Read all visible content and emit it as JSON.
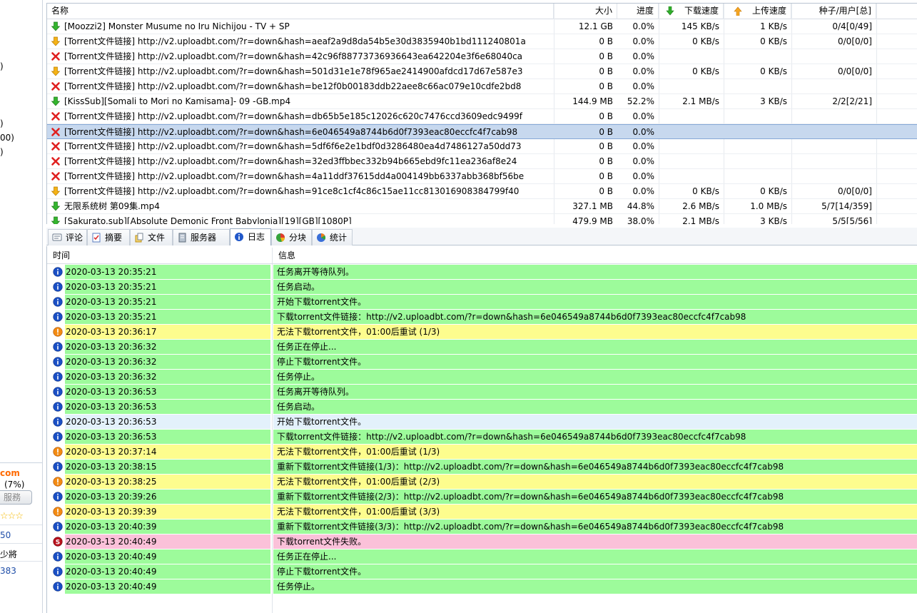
{
  "sidebar": {
    "fragments": [
      ")",
      ")",
      "00)",
      ")"
    ],
    "brand": "com",
    "percent": "(7%)",
    "service_button": "服務",
    "stars": "☆☆☆",
    "link1": "50",
    "text1": "少將",
    "link2": "383"
  },
  "torrent_list": {
    "columns": [
      "名称",
      "大小",
      "进度",
      "下载速度",
      "上传速度",
      "种子/用户[总]"
    ],
    "rows": [
      {
        "status": "downloading",
        "name": "[Moozzi2] Monster Musume no Iru Nichijou - TV + SP",
        "size": "12.1 GB",
        "progress": "0.0%",
        "down": "145 KB/s",
        "up": "1 KB/s",
        "peers": "0/4[0/49]"
      },
      {
        "status": "queued",
        "name": "[Torrent文件链接] http://v2.uploadbt.com/?r=down&hash=aeaf2a9d8da54b5e30d3835940b1bd111240801a",
        "size": "0 B",
        "progress": "0.0%",
        "down": "0 KB/s",
        "up": "0 KB/s",
        "peers": "0/0[0/0]"
      },
      {
        "status": "error",
        "name": "[Torrent文件链接] http://v2.uploadbt.com/?r=down&hash=42c96f88773736936643ea642204e3f6e68040ca",
        "size": "0 B",
        "progress": "0.0%",
        "down": "",
        "up": "",
        "peers": ""
      },
      {
        "status": "queued",
        "name": "[Torrent文件链接] http://v2.uploadbt.com/?r=down&hash=501d31e1e78f965ae2414900afdcd17d67e587e3",
        "size": "0 B",
        "progress": "0.0%",
        "down": "0 KB/s",
        "up": "0 KB/s",
        "peers": "0/0[0/0]"
      },
      {
        "status": "error",
        "name": "[Torrent文件链接] http://v2.uploadbt.com/?r=down&hash=be12f0b00183ddb22aee8c66ac079e10cdfe2bd8",
        "size": "0 B",
        "progress": "0.0%",
        "down": "",
        "up": "",
        "peers": ""
      },
      {
        "status": "downloading",
        "name": "[KissSub][Somali to Mori no Kamisama]- 09 -GB.mp4",
        "size": "144.9 MB",
        "progress": "52.2%",
        "down": "2.1 MB/s",
        "up": "3 KB/s",
        "peers": "2/2[2/21]"
      },
      {
        "status": "error",
        "name": "[Torrent文件链接] http://v2.uploadbt.com/?r=down&hash=db65b5e185c12026c620c7476ccd3609edc9499f",
        "size": "0 B",
        "progress": "0.0%",
        "down": "",
        "up": "",
        "peers": ""
      },
      {
        "status": "error",
        "selected": true,
        "name": "[Torrent文件链接] http://v2.uploadbt.com/?r=down&hash=6e046549a8744b6d0f7393eac80eccfc4f7cab98",
        "size": "0 B",
        "progress": "0.0%",
        "down": "",
        "up": "",
        "peers": ""
      },
      {
        "status": "error",
        "name": "[Torrent文件链接] http://v2.uploadbt.com/?r=down&hash=5df6f6e2e1bdf0d3286480ea4d7486127a50dd73",
        "size": "0 B",
        "progress": "0.0%",
        "down": "",
        "up": "",
        "peers": ""
      },
      {
        "status": "error",
        "name": "[Torrent文件链接] http://v2.uploadbt.com/?r=down&hash=32ed3ffbbec332b94b665ebd9fc11ea236af8e24",
        "size": "0 B",
        "progress": "0.0%",
        "down": "",
        "up": "",
        "peers": ""
      },
      {
        "status": "error",
        "name": "[Torrent文件链接] http://v2.uploadbt.com/?r=down&hash=4a11ddf37615dd4a004149bb6337abb368bf56be",
        "size": "0 B",
        "progress": "0.0%",
        "down": "",
        "up": "",
        "peers": ""
      },
      {
        "status": "queued",
        "name": "[Torrent文件链接] http://v2.uploadbt.com/?r=down&hash=91ce8c1cf4c86c15ae11cc813016908384799f40",
        "size": "0 B",
        "progress": "0.0%",
        "down": "0 KB/s",
        "up": "0 KB/s",
        "peers": "0/0[0/0]"
      },
      {
        "status": "downloading",
        "name": "无限系统树 第09集.mp4",
        "size": "327.1 MB",
        "progress": "44.8%",
        "down": "2.6 MB/s",
        "up": "1.0 MB/s",
        "peers": "5/7[14/359]"
      },
      {
        "status": "downloading",
        "name": "[Sakurato.sub][Absolute Demonic Front Babylonia][19][GB][1080P]",
        "size": "479.9 MB",
        "progress": "38.0%",
        "down": "2.1 MB/s",
        "up": "3 KB/s",
        "peers": "5/5[5/56]"
      }
    ]
  },
  "tabs": [
    {
      "label": "评论",
      "icon": "comment-icon"
    },
    {
      "label": "摘要",
      "icon": "summary-icon"
    },
    {
      "label": "文件",
      "icon": "file-icon"
    },
    {
      "label": "服务器",
      "icon": "server-icon"
    },
    {
      "label": "日志",
      "icon": "info-icon",
      "active": true
    },
    {
      "label": "分块",
      "icon": "pieces-icon"
    },
    {
      "label": "统计",
      "icon": "stats-icon"
    }
  ],
  "log": {
    "columns": [
      "时间",
      "信息"
    ],
    "rows": [
      {
        "level": "info",
        "time": "2020-03-13 20:35:21",
        "msg": "任务离开等待队列。"
      },
      {
        "level": "info",
        "time": "2020-03-13 20:35:21",
        "msg": "任务启动。"
      },
      {
        "level": "info",
        "time": "2020-03-13 20:35:21",
        "msg": "开始下载torrent文件。"
      },
      {
        "level": "info",
        "time": "2020-03-13 20:35:21",
        "msg": "下载torrent文件链接：http://v2.uploadbt.com/?r=down&hash=6e046549a8744b6d0f7393eac80eccfc4f7cab98"
      },
      {
        "level": "warn",
        "time": "2020-03-13 20:36:17",
        "msg": "无法下载torrent文件，01:00后重试 (1/3)"
      },
      {
        "level": "info",
        "time": "2020-03-13 20:36:32",
        "msg": "任务正在停止..."
      },
      {
        "level": "info",
        "time": "2020-03-13 20:36:32",
        "msg": "停止下载torrent文件。"
      },
      {
        "level": "info",
        "time": "2020-03-13 20:36:32",
        "msg": "任务停止。"
      },
      {
        "level": "info",
        "time": "2020-03-13 20:36:53",
        "msg": "任务离开等待队列。"
      },
      {
        "level": "info",
        "time": "2020-03-13 20:36:53",
        "msg": "任务启动。"
      },
      {
        "level": "info",
        "time": "2020-03-13 20:36:53",
        "msg": "开始下载torrent文件。",
        "highlight": true
      },
      {
        "level": "info",
        "time": "2020-03-13 20:36:53",
        "msg": "下载torrent文件链接：http://v2.uploadbt.com/?r=down&hash=6e046549a8744b6d0f7393eac80eccfc4f7cab98"
      },
      {
        "level": "warn",
        "time": "2020-03-13 20:37:14",
        "msg": "无法下载torrent文件，01:00后重试 (1/3)"
      },
      {
        "level": "info",
        "time": "2020-03-13 20:38:15",
        "msg": "重新下载torrent文件链接(1/3)：http://v2.uploadbt.com/?r=down&hash=6e046549a8744b6d0f7393eac80eccfc4f7cab98"
      },
      {
        "level": "warn",
        "time": "2020-03-13 20:38:25",
        "msg": "无法下载torrent文件，01:00后重试 (2/3)"
      },
      {
        "level": "info",
        "time": "2020-03-13 20:39:26",
        "msg": "重新下载torrent文件链接(2/3)：http://v2.uploadbt.com/?r=down&hash=6e046549a8744b6d0f7393eac80eccfc4f7cab98"
      },
      {
        "level": "warn",
        "time": "2020-03-13 20:39:39",
        "msg": "无法下载torrent文件，01:00后重试 (3/3)"
      },
      {
        "level": "info",
        "time": "2020-03-13 20:40:39",
        "msg": "重新下载torrent文件链接(3/3)：http://v2.uploadbt.com/?r=down&hash=6e046549a8744b6d0f7393eac80eccfc4f7cab98"
      },
      {
        "level": "error",
        "time": "2020-03-13 20:40:49",
        "msg": "下载torrent文件失败。"
      },
      {
        "level": "info",
        "time": "2020-03-13 20:40:49",
        "msg": "任务正在停止..."
      },
      {
        "level": "info",
        "time": "2020-03-13 20:40:49",
        "msg": "停止下载torrent文件。"
      },
      {
        "level": "info",
        "time": "2020-03-13 20:40:49",
        "msg": "任务停止。"
      }
    ]
  },
  "colors": {
    "info_row": "#9dfb9b",
    "warn_row": "#fdfd8e",
    "error_row": "#fbc1d9",
    "highlight_row": "#e3f1fb",
    "selected_row": "#c7d8ee"
  }
}
